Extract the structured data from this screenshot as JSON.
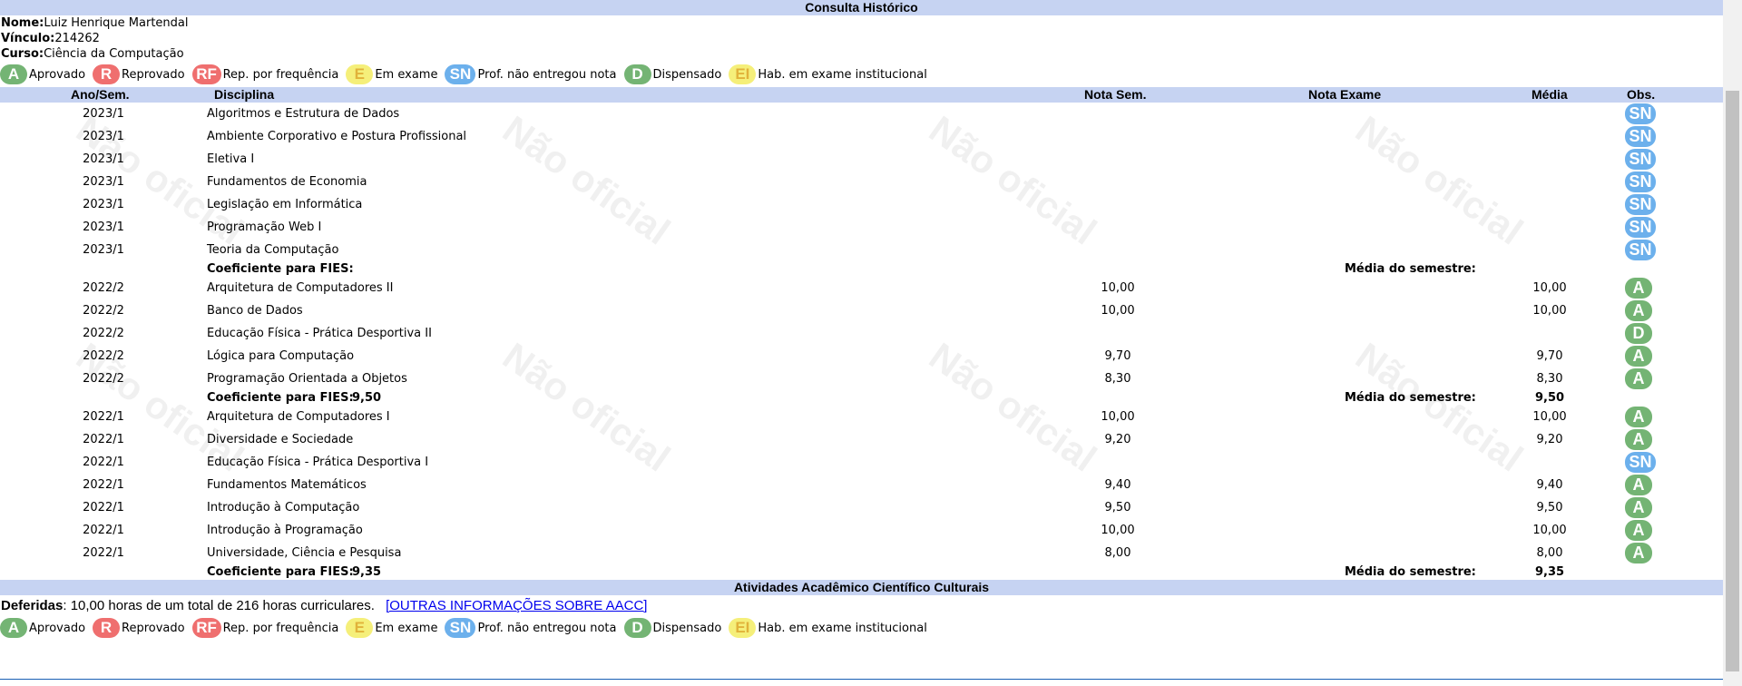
{
  "header": {
    "title": "Consulta Histórico"
  },
  "student": {
    "name_label": "Nome:",
    "name": "Luiz Henrique Martendal",
    "vinculo_label": "Vínculo:",
    "vinculo": "214262",
    "curso_label": "Curso:",
    "curso": "Ciência da Computação"
  },
  "legend": [
    {
      "code": "A",
      "label": "Aprovado"
    },
    {
      "code": "R",
      "label": "Reprovado"
    },
    {
      "code": "RF",
      "label": "Rep. por frequência"
    },
    {
      "code": "E",
      "label": "Em exame"
    },
    {
      "code": "SN",
      "label": "Prof. não entregou nota"
    },
    {
      "code": "D",
      "label": "Dispensado"
    },
    {
      "code": "EI",
      "label": "Hab. em exame institucional"
    }
  ],
  "table": {
    "headers": {
      "ano": "Ano/Sem.",
      "disciplina": "Disciplina",
      "nota_sem": "Nota Sem.",
      "nota_exame": "Nota Exame",
      "media": "Média",
      "obs": "Obs."
    },
    "coef_label": "Coeficiente para FIES:",
    "media_sem_label": "Média do semestre:",
    "semesters": [
      {
        "rows": [
          {
            "ano": "2023/1",
            "disciplina": "Algoritmos e Estrutura de Dados",
            "nota": "",
            "media": "",
            "obs": "SN"
          },
          {
            "ano": "2023/1",
            "disciplina": "Ambiente Corporativo e Postura Profissional",
            "nota": "",
            "media": "",
            "obs": "SN"
          },
          {
            "ano": "2023/1",
            "disciplina": "Eletiva I",
            "nota": "",
            "media": "",
            "obs": "SN"
          },
          {
            "ano": "2023/1",
            "disciplina": "Fundamentos de Economia",
            "nota": "",
            "media": "",
            "obs": "SN"
          },
          {
            "ano": "2023/1",
            "disciplina": "Legislação em Informática",
            "nota": "",
            "media": "",
            "obs": "SN"
          },
          {
            "ano": "2023/1",
            "disciplina": "Programação Web I",
            "nota": "",
            "media": "",
            "obs": "SN"
          },
          {
            "ano": "2023/1",
            "disciplina": "Teoria da Computação",
            "nota": "",
            "media": "",
            "obs": "SN"
          }
        ],
        "coef": "",
        "media_sem": ""
      },
      {
        "rows": [
          {
            "ano": "2022/2",
            "disciplina": "Arquitetura de Computadores II",
            "nota": "10,00",
            "media": "10,00",
            "obs": "A"
          },
          {
            "ano": "2022/2",
            "disciplina": "Banco de Dados",
            "nota": "10,00",
            "media": "10,00",
            "obs": "A"
          },
          {
            "ano": "2022/2",
            "disciplina": "Educação Física - Prática Desportiva II",
            "nota": "",
            "media": "",
            "obs": "D"
          },
          {
            "ano": "2022/2",
            "disciplina": "Lógica para Computação",
            "nota": "9,70",
            "media": "9,70",
            "obs": "A"
          },
          {
            "ano": "2022/2",
            "disciplina": "Programação Orientada a Objetos",
            "nota": "8,30",
            "media": "8,30",
            "obs": "A"
          }
        ],
        "coef": "9,50",
        "media_sem": "9,50"
      },
      {
        "rows": [
          {
            "ano": "2022/1",
            "disciplina": "Arquitetura de Computadores I",
            "nota": "10,00",
            "media": "10,00",
            "obs": "A"
          },
          {
            "ano": "2022/1",
            "disciplina": "Diversidade e Sociedade",
            "nota": "9,20",
            "media": "9,20",
            "obs": "A"
          },
          {
            "ano": "2022/1",
            "disciplina": "Educação Física - Prática Desportiva I",
            "nota": "",
            "media": "",
            "obs": "SN"
          },
          {
            "ano": "2022/1",
            "disciplina": "Fundamentos Matemáticos",
            "nota": "9,40",
            "media": "9,40",
            "obs": "A"
          },
          {
            "ano": "2022/1",
            "disciplina": "Introdução à Computação",
            "nota": "9,50",
            "media": "9,50",
            "obs": "A"
          },
          {
            "ano": "2022/1",
            "disciplina": "Introdução à Programação",
            "nota": "10,00",
            "media": "10,00",
            "obs": "A"
          },
          {
            "ano": "2022/1",
            "disciplina": "Universidade, Ciência e Pesquisa",
            "nota": "8,00",
            "media": "8,00",
            "obs": "A"
          }
        ],
        "coef": "9,35",
        "media_sem": "9,35"
      }
    ]
  },
  "watermark": "Não oficial",
  "aacc": {
    "title": "Atividades Acadêmico Científico Culturais",
    "deferidas_label": "Deferidas",
    "deferidas_text": ": 10,00 horas de um total de 216 horas curriculares.",
    "link": "[OUTRAS INFORMAÇÕES SOBRE AACC]"
  },
  "colors": {
    "header_bg": "#c6d3f2",
    "approved": "#74b474",
    "failed": "#ef6f6f",
    "exam": "#f5ef7a",
    "no_grade": "#6cb0ec"
  }
}
